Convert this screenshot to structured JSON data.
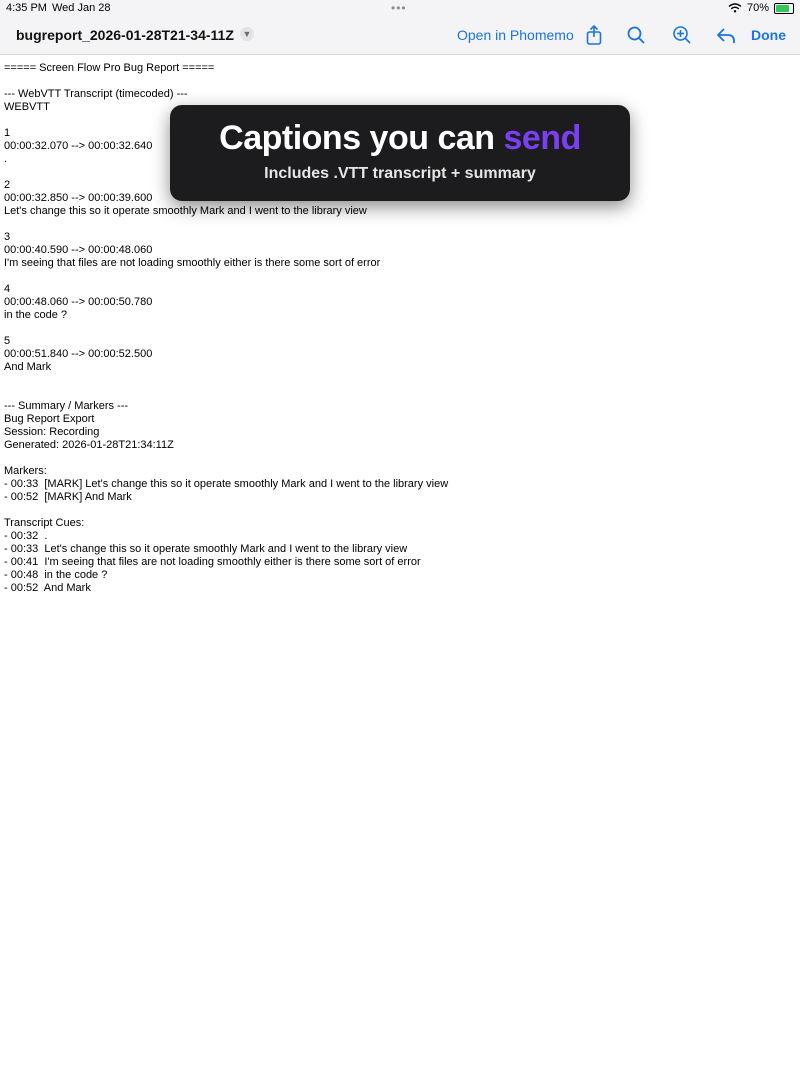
{
  "status_bar": {
    "time": "4:35 PM",
    "date": "Wed Jan 28",
    "battery": "70%",
    "battery_level": 0.7
  },
  "toolbar": {
    "title": "bugreport_2026-01-28T21-34-11Z",
    "open_in_label": "Open in Phomemo",
    "done_label": "Done",
    "accent_color": "#1a73e8"
  },
  "document": {
    "lines": [
      "===== Screen Flow Pro Bug Report =====",
      "",
      "--- WebVTT Transcript (timecoded) ---",
      "WEBVTT",
      "",
      "1",
      "00:00:32.070 --> 00:00:32.640",
      ".",
      "",
      "2",
      "00:00:32.850 --> 00:00:39.600",
      "Let's change this so it operate smoothly Mark and I went to the library view",
      "",
      "3",
      "00:00:40.590 --> 00:00:48.060",
      "I'm seeing that files are not loading smoothly either is there some sort of error",
      "",
      "4",
      "00:00:48.060 --> 00:00:50.780",
      "in the code ?",
      "",
      "5",
      "00:00:51.840 --> 00:00:52.500",
      "And Mark",
      "",
      "",
      "--- Summary / Markers ---",
      "Bug Report Export",
      "Session: Recording",
      "Generated: 2026-01-28T21:34:11Z",
      "",
      "Markers:",
      "- 00:33  [MARK] Let's change this so it operate smoothly Mark and I went to the library view",
      "- 00:52  [MARK] And Mark",
      "",
      "Transcript Cues:",
      "- 00:32  .",
      "- 00:33  Let's change this so it operate smoothly Mark and I went to the library view",
      "- 00:41  I'm seeing that files are not loading smoothly either is there some sort of error",
      "- 00:48  in the code ?",
      "- 00:52  And Mark"
    ]
  },
  "overlay": {
    "headline_prefix": "Captions you can ",
    "headline_accent": "send",
    "subtitle": "Includes .VTT transcript + summary",
    "accent_color": "#7b3ff2"
  },
  "icons": [
    "chevron-down-icon",
    "share-icon",
    "search-icon",
    "zoom-in-icon",
    "reply-icon",
    "wifi-icon",
    "battery-icon"
  ]
}
